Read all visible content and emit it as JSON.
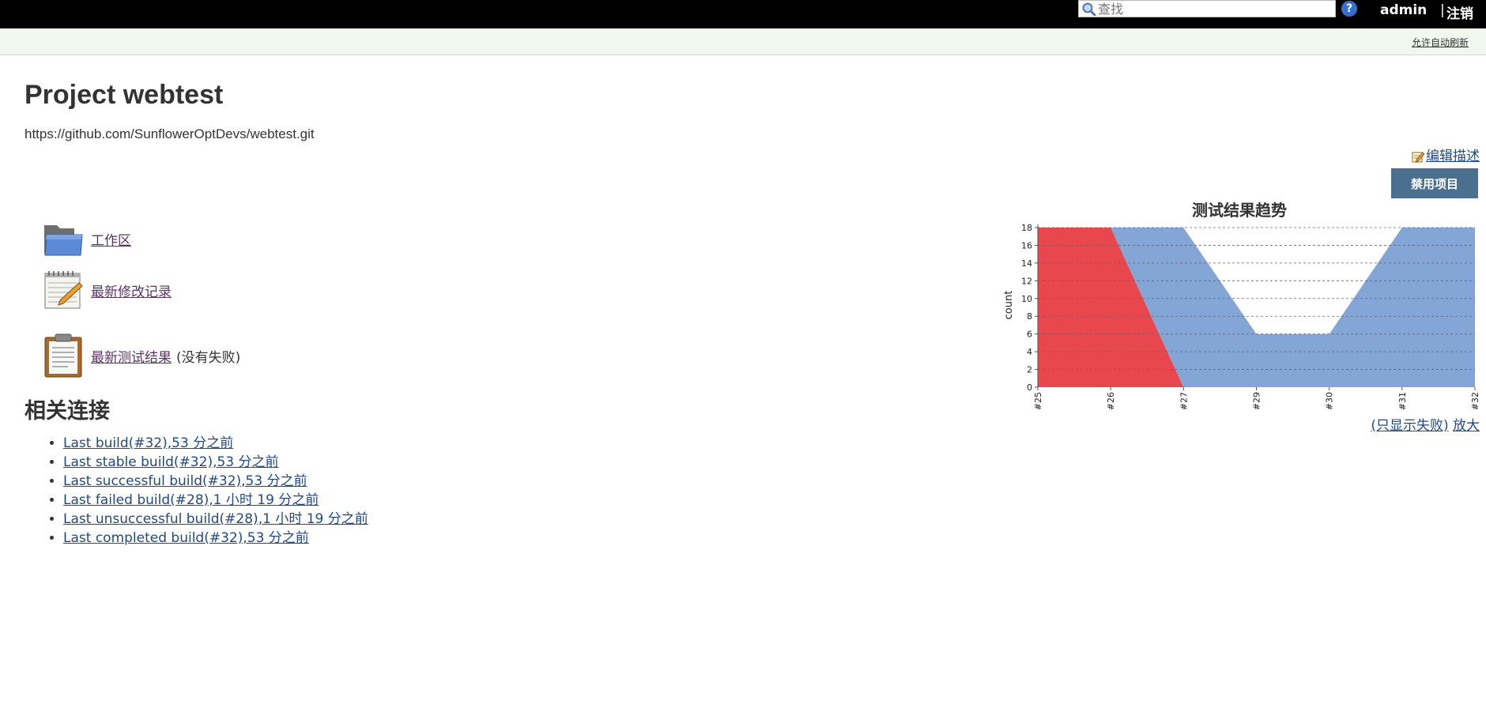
{
  "header": {
    "search_placeholder": "查找",
    "help_symbol": "?",
    "user": "admin",
    "logout_separator": "|",
    "logout": "注销"
  },
  "subbar": {
    "auto_refresh": "允许自动刷新"
  },
  "project": {
    "title": "Project webtest",
    "description": "https://github.com/SunflowerOptDevs/webtest.git"
  },
  "actions": {
    "edit_description": "编辑描述",
    "disable_project": "禁用项目"
  },
  "tasks": [
    {
      "label": "工作区",
      "icon": "folder-icon"
    },
    {
      "label": "最新修改记录",
      "icon": "notepad-icon"
    },
    {
      "label": "最新测试结果",
      "note": "(没有失败)",
      "icon": "clipboard-icon"
    }
  ],
  "permalinks": {
    "heading": "相关连接",
    "items": [
      "Last build(#32),53 分之前",
      "Last stable build(#32),53 分之前",
      "Last successful build(#32),53 分之前",
      "Last failed build(#28),1 小时 19 分之前",
      "Last unsuccessful build(#28),1 小时 19 分之前",
      "Last completed build(#32),53 分之前"
    ]
  },
  "chart_links": {
    "only_failures": "(只显示失败)",
    "enlarge": "放大"
  },
  "colors": {
    "topbar": "#000000",
    "subbar": "#f2f7f0",
    "disable_button": "#4b708f",
    "fail": "#e8474e",
    "pass": "#84a6d6",
    "link": "#204A87",
    "visited_link": "#5c3566"
  },
  "chart_data": {
    "type": "area",
    "title": "测试结果趋势",
    "ylabel": "count",
    "xlabel": "",
    "categories": [
      "#25",
      "#26",
      "#27",
      "#29",
      "#30",
      "#31",
      "#32"
    ],
    "ylim": [
      0,
      18
    ],
    "yticks": [
      0,
      2,
      4,
      6,
      8,
      10,
      12,
      14,
      16,
      18
    ],
    "grid": true,
    "stacked": true,
    "series": [
      {
        "name": "fail",
        "color": "#e8474e",
        "values": [
          18,
          18,
          0,
          0,
          0,
          0,
          0
        ]
      },
      {
        "name": "pass",
        "color": "#84a6d6",
        "values": [
          0,
          0,
          18,
          6,
          6,
          18,
          18
        ]
      }
    ]
  }
}
